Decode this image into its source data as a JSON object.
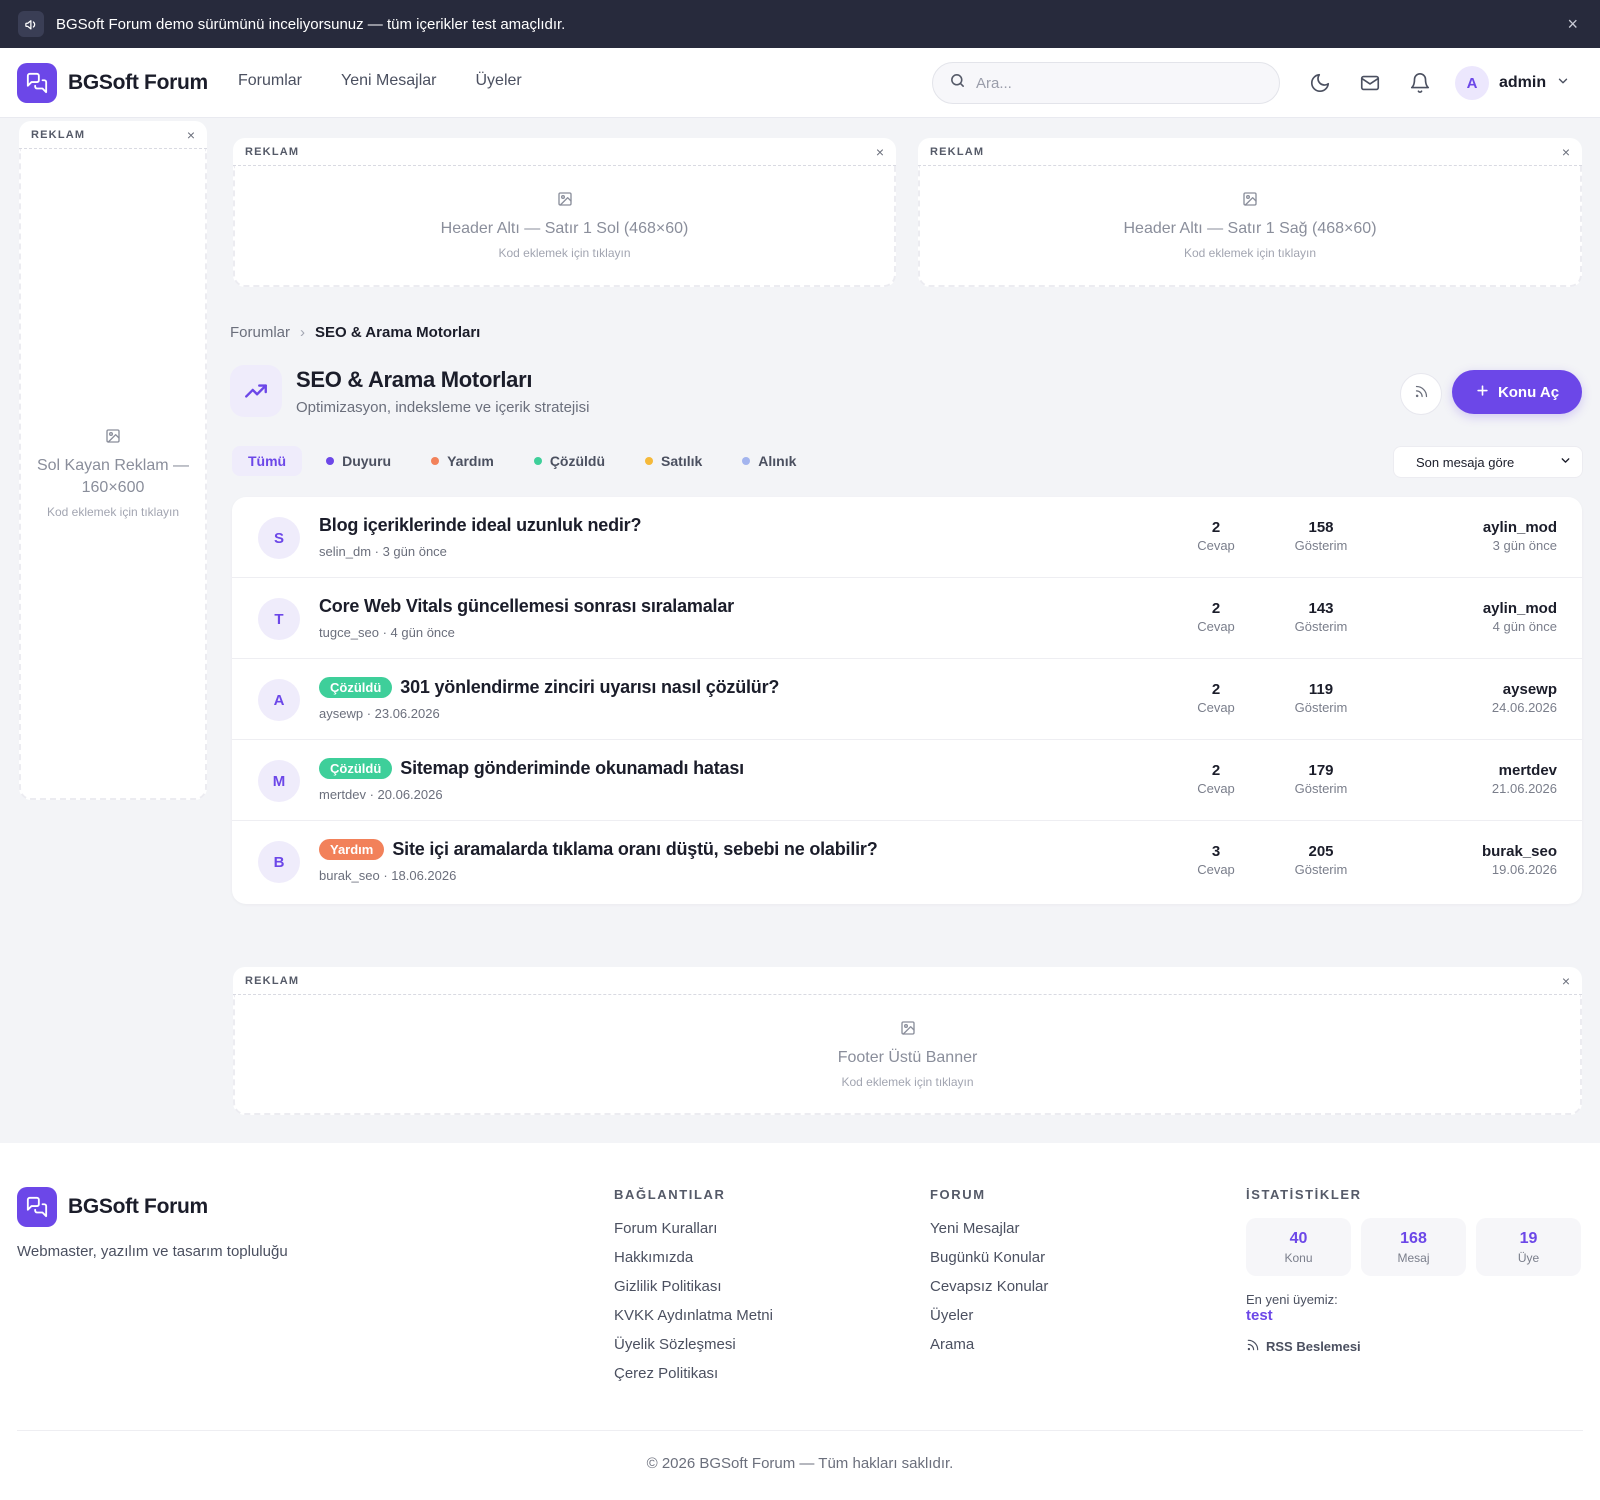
{
  "demo_bar": {
    "text": "BGSoft Forum demo sürümünü inceliyorsunuz — tüm içerikler test amaçlıdır.",
    "close": "×"
  },
  "header": {
    "brand": "BGSoft Forum",
    "nav": [
      "Forumlar",
      "Yeni Mesajlar",
      "Üyeler"
    ],
    "search_placeholder": "Ara...",
    "user_initial": "A",
    "user_name": "admin"
  },
  "ads": {
    "label": "REKLAM",
    "close": "×",
    "left": {
      "title": "Sol Kayan Reklam — 160×600",
      "hint": "Kod eklemek için tıklayın"
    },
    "top_left": {
      "title": "Header Altı — Satır 1 Sol (468×60)",
      "hint": "Kod eklemek için tıklayın"
    },
    "top_right": {
      "title": "Header Altı — Satır 1 Sağ (468×60)",
      "hint": "Kod eklemek için tıklayın"
    },
    "footer": {
      "title": "Footer Üstü Banner",
      "hint": "Kod eklemek için tıklayın"
    }
  },
  "breadcrumb": {
    "root": "Forumlar",
    "separator": "›",
    "current": "SEO & Arama Motorları"
  },
  "forum": {
    "title": "SEO & Arama Motorları",
    "description": "Optimizasyon, indeksleme ve içerik stratejisi",
    "new_topic_label": "Konu Aç"
  },
  "filters": [
    {
      "label": "Tümü",
      "color": ""
    },
    {
      "label": "Duyuru",
      "color": "#6c47e8"
    },
    {
      "label": "Yardım",
      "color": "#f2815a"
    },
    {
      "label": "Çözüldü",
      "color": "#3ecf9a"
    },
    {
      "label": "Satılık",
      "color": "#f5b93a"
    },
    {
      "label": "Alınık",
      "color": "#a3b4ee"
    }
  ],
  "sort": {
    "selected": "Son mesaja göre"
  },
  "stat_labels": {
    "replies": "Cevap",
    "views": "Gösterim"
  },
  "topics": [
    {
      "initial": "S",
      "badge": "",
      "badge_color": "",
      "title": "Blog içeriklerinde ideal uzunluk nedir?",
      "meta": "selin_dm · 3 gün önce",
      "replies": "2",
      "views": "158",
      "last_user": "aylin_mod",
      "last_time": "3 gün önce"
    },
    {
      "initial": "T",
      "badge": "",
      "badge_color": "",
      "title": "Core Web Vitals güncellemesi sonrası sıralamalar",
      "meta": "tugce_seo · 4 gün önce",
      "replies": "2",
      "views": "143",
      "last_user": "aylin_mod",
      "last_time": "4 gün önce"
    },
    {
      "initial": "A",
      "badge": "Çözüldü",
      "badge_color": "#3ecf9a",
      "title": "301 yönlendirme zinciri uyarısı nasıl çözülür?",
      "meta": "aysewp · 23.06.2026",
      "replies": "2",
      "views": "119",
      "last_user": "aysewp",
      "last_time": "24.06.2026"
    },
    {
      "initial": "M",
      "badge": "Çözüldü",
      "badge_color": "#3ecf9a",
      "title": "Sitemap gönderiminde okunamadı hatası",
      "meta": "mertdev · 20.06.2026",
      "replies": "2",
      "views": "179",
      "last_user": "mertdev",
      "last_time": "21.06.2026"
    },
    {
      "initial": "B",
      "badge": "Yardım",
      "badge_color": "#f2815a",
      "title": "Site içi aramalarda tıklama oranı düştü, sebebi ne olabilir?",
      "meta": "burak_seo · 18.06.2026",
      "replies": "3",
      "views": "205",
      "last_user": "burak_seo",
      "last_time": "19.06.2026"
    }
  ],
  "footer": {
    "brand": "BGSoft Forum",
    "tagline": "Webmaster, yazılım ve tasarım topluluğu",
    "links_title": "BAĞLANTILAR",
    "links": [
      "Forum Kuralları",
      "Hakkımızda",
      "Gizlilik Politikası",
      "KVKK Aydınlatma Metni",
      "Üyelik Sözleşmesi",
      "Çerez Politikası"
    ],
    "forum_title": "FORUM",
    "forum_links": [
      "Yeni Mesajlar",
      "Bugünkü Konular",
      "Cevapsız Konular",
      "Üyeler",
      "Arama"
    ],
    "stats_title": "İSTATİSTİKLER",
    "stats": [
      {
        "value": "40",
        "label": "Konu"
      },
      {
        "value": "168",
        "label": "Mesaj"
      },
      {
        "value": "19",
        "label": "Üye"
      }
    ],
    "newest_label": "En yeni üyemiz:",
    "newest_user": "test",
    "rss_label": "RSS Beslemesi",
    "copyright": "© 2026 BGSoft Forum — Tüm hakları saklıdır."
  },
  "colors": {
    "accent": "#6c47e8",
    "topbar": "#272a3c"
  }
}
